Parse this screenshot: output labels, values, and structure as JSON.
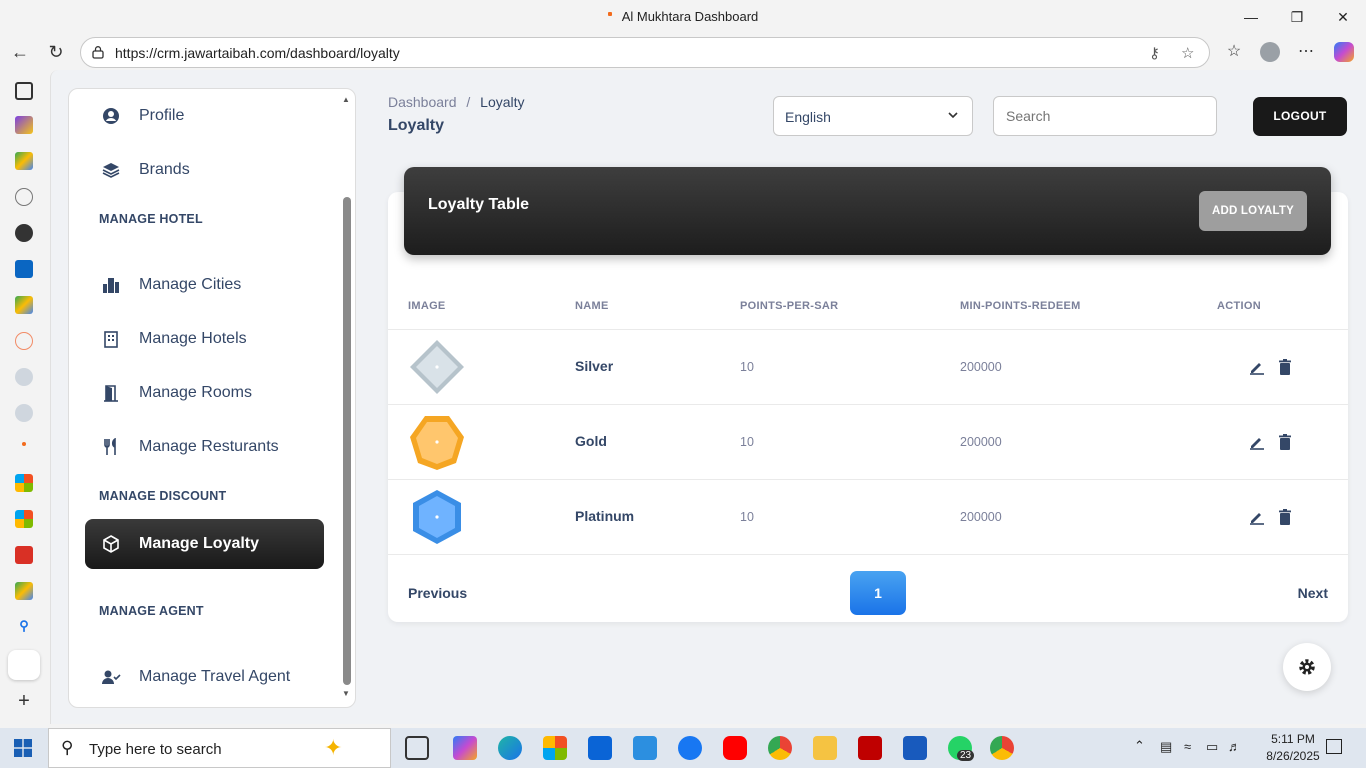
{
  "window": {
    "title": "Al Mukhtara Dashboard"
  },
  "browser": {
    "url": "https://crm.jawartaibah.com/dashboard/loyalty"
  },
  "sidebar": {
    "items_top": [
      {
        "label": "Profile",
        "icon": "user-circle-icon"
      },
      {
        "label": "Brands",
        "icon": "layers-icon"
      }
    ],
    "sections": [
      {
        "title": "MANAGE HOTEL",
        "items": [
          "Manage Cities",
          "Manage Hotels",
          "Manage Rooms",
          "Manage Resturants"
        ]
      },
      {
        "title": "MANAGE DISCOUNT",
        "items": [
          "Manage Loyalty"
        ]
      },
      {
        "title": "MANAGE AGENT",
        "items": [
          "Manage Travel Agent"
        ]
      }
    ],
    "active": "Manage Loyalty"
  },
  "header": {
    "breadcrumb_root": "Dashboard",
    "breadcrumb_sep": "/",
    "breadcrumb_current": "Loyalty",
    "page_title": "Loyalty",
    "language": "English",
    "search_placeholder": "Search",
    "logout_label": "LOGOUT"
  },
  "table": {
    "title": "Loyalty Table",
    "add_label": "ADD LOYALTY",
    "columns": [
      "IMAGE",
      "NAME",
      "POINTS-PER-SAR",
      "MIN-POINTS-REDEEM",
      "ACTION"
    ],
    "rows": [
      {
        "name": "Silver",
        "points_per_sar": "10",
        "min_points_redeem": "200000",
        "gem_color": "#b8c4cc"
      },
      {
        "name": "Gold",
        "points_per_sar": "10",
        "min_points_redeem": "200000",
        "gem_color": "#f5a623"
      },
      {
        "name": "Platinum",
        "points_per_sar": "10",
        "min_points_redeem": "200000",
        "gem_color": "#3a8ee6"
      }
    ]
  },
  "pagination": {
    "previous": "Previous",
    "next": "Next",
    "current": "1"
  },
  "taskbar": {
    "search_placeholder": "Type here to search",
    "time": "5:11 PM",
    "date": "8/26/2025",
    "whatsapp_badge": "23"
  }
}
